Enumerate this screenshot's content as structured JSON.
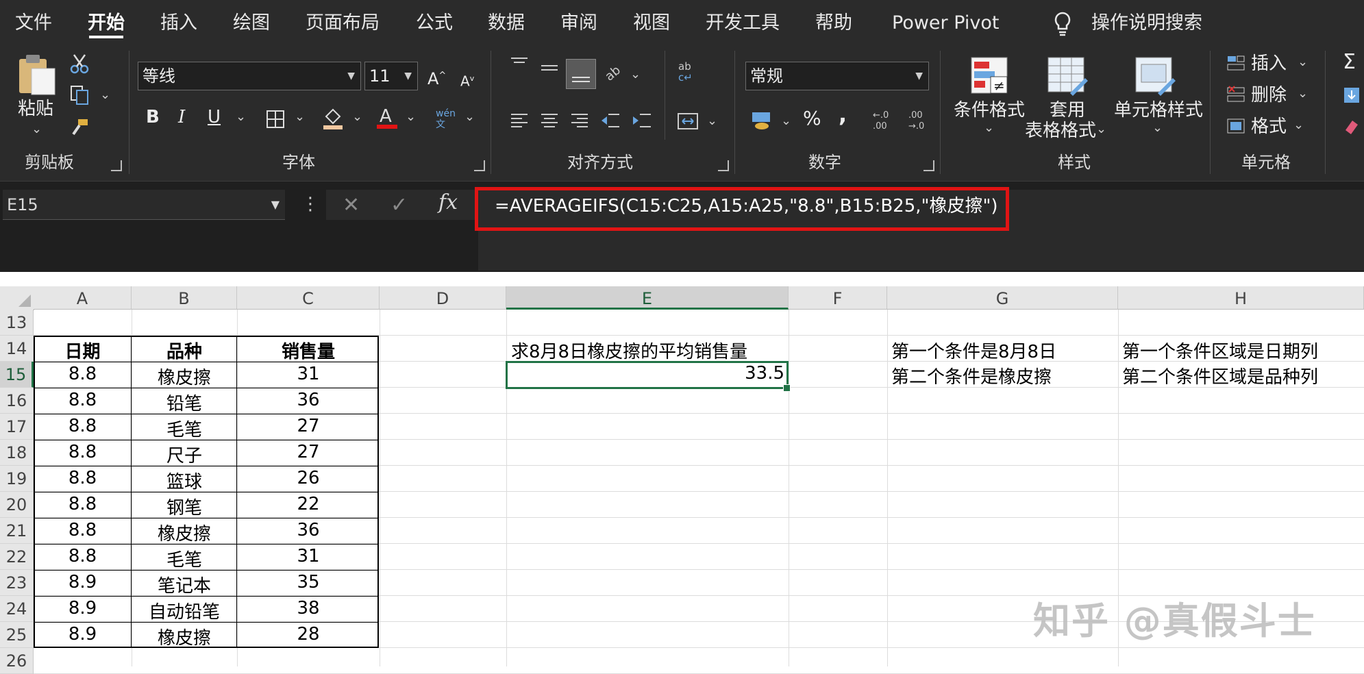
{
  "ribbon_tabs": [
    "文件",
    "开始",
    "插入",
    "绘图",
    "页面布局",
    "公式",
    "数据",
    "审阅",
    "视图",
    "开发工具",
    "帮助",
    "Power Pivot"
  ],
  "tell_me": "操作说明搜索",
  "clipboard": {
    "paste": "粘贴",
    "group": "剪贴板"
  },
  "font": {
    "name": "等线",
    "size": "11",
    "bold": "B",
    "italic": "I",
    "underline": "U",
    "group": "字体",
    "phonetic": "wén\n文"
  },
  "align": {
    "group": "对齐方式"
  },
  "number": {
    "format": "常规",
    "group": "数字",
    "percent": "%",
    "comma": ","
  },
  "styles": {
    "conditional": "条件格式",
    "table1": "套用",
    "table2": "表格格式",
    "cell_styles": "单元格样式",
    "group": "样式"
  },
  "cells": {
    "insert": "插入",
    "delete": "删除",
    "format": "格式",
    "group": "单元格"
  },
  "name_box": "E15",
  "formula": "=AVERAGEIFS(C15:C25,A15:A25,\"8.8\",B15:B25,\"橡皮擦\")",
  "fx": "fx",
  "columns": [
    "A",
    "B",
    "C",
    "D",
    "E",
    "F",
    "G",
    "H"
  ],
  "rows": [
    "13",
    "14",
    "15",
    "16",
    "17",
    "18",
    "19",
    "20",
    "21",
    "22",
    "23",
    "24",
    "25",
    "26"
  ],
  "table": {
    "headers": [
      "日期",
      "品种",
      "销售量"
    ],
    "rows": [
      [
        "8.8",
        "橡皮擦",
        "31"
      ],
      [
        "8.8",
        "铅笔",
        "36"
      ],
      [
        "8.8",
        "毛笔",
        "27"
      ],
      [
        "8.8",
        "尺子",
        "27"
      ],
      [
        "8.8",
        "篮球",
        "26"
      ],
      [
        "8.8",
        "钢笔",
        "22"
      ],
      [
        "8.8",
        "橡皮擦",
        "36"
      ],
      [
        "8.8",
        "毛笔",
        "31"
      ],
      [
        "8.9",
        "笔记本",
        "35"
      ],
      [
        "8.9",
        "自动铅笔",
        "38"
      ],
      [
        "8.9",
        "橡皮擦",
        "28"
      ]
    ]
  },
  "e14": "求8月8日橡皮擦的平均销售量",
  "e15": "33.5",
  "g14": "第一个条件是8月8日",
  "g15": "第二个条件是橡皮擦",
  "h14": "第一个条件区域是日期列",
  "h15": "第二个条件区域是品种列",
  "watermark": "知乎 @真假斗士",
  "colors": {
    "ribbon_bg": "#2b2b2b",
    "highlight": "#e11414",
    "selection": "#217346"
  }
}
